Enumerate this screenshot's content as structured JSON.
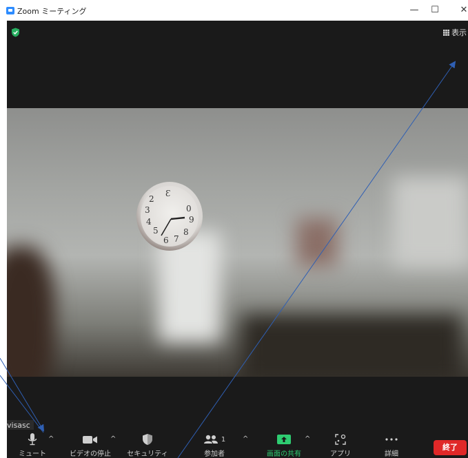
{
  "window": {
    "title": "Zoom ミーティング",
    "controls": {
      "minimize": "—",
      "maximize": "☐",
      "close": "✕"
    }
  },
  "meeting": {
    "view_label": "表示",
    "participant_name": "visasc",
    "security_status_color": "#27ae60"
  },
  "toolbar": {
    "mute_label": "ミュート",
    "video_label": "ビデオの停止",
    "security_label": "セキュリティ",
    "participants_label": "参加者",
    "participants_count": "1",
    "share_label": "画面の共有",
    "apps_label": "アプリ",
    "more_label": "詳細",
    "end_label": "終了",
    "share_color": "#2ecc71",
    "end_color": "#e02828"
  },
  "annotations": {
    "arrow_color": "#2f5fb3"
  }
}
